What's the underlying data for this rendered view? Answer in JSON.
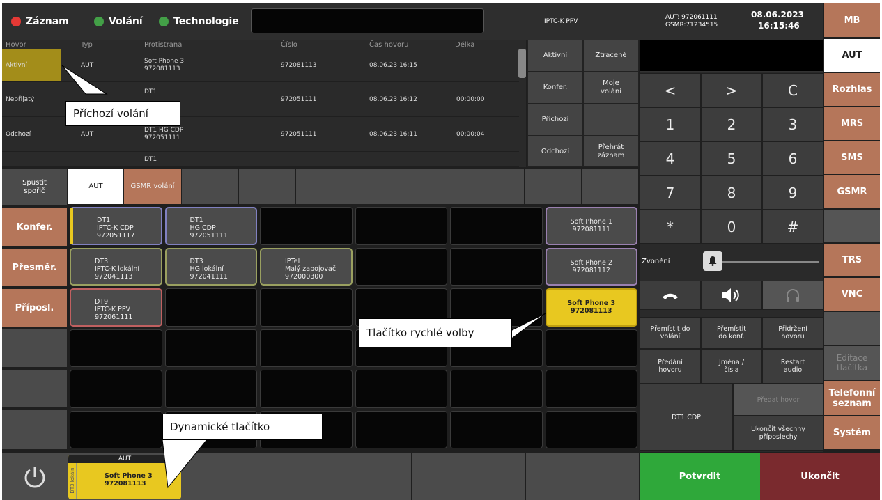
{
  "header": {
    "indicators": [
      {
        "label": "Záznam",
        "color": "#e53935"
      },
      {
        "label": "Volání",
        "color": "#43a047"
      },
      {
        "label": "Technologie",
        "color": "#43a047"
      }
    ],
    "center_label": "IPTC-K PPV",
    "aut_line": "AUT: 972061111",
    "gsmr_line": "GSMR:71234515",
    "date": "08.06.2023",
    "time": "16:15:46"
  },
  "history": {
    "columns": [
      "Hovor",
      "Typ",
      "Protistrana",
      "Číslo",
      "Čas hovoru",
      "Délka"
    ],
    "rows": [
      {
        "status": "Aktivní",
        "type": "AUT",
        "party1": "Soft Phone 3",
        "party2": "972081113",
        "number": "972081113",
        "time": "08.06.23 16:15",
        "length": ""
      },
      {
        "status": "Nepřijatý",
        "type": "",
        "party1": "DT1",
        "party2": "",
        "number": "972051111",
        "time": "08.06.23 16:12",
        "length": "00:00:00"
      },
      {
        "status": "Odchozí",
        "type": "AUT",
        "party1": "DT1 HG CDP",
        "party2": "972051111",
        "number": "972051111",
        "time": "08.06.23 16:11",
        "length": "00:00:04"
      },
      {
        "status": "",
        "type": "",
        "party1": "DT1",
        "party2": "",
        "number": "",
        "time": "",
        "length": ""
      }
    ]
  },
  "filters": [
    [
      "Aktivní",
      "Ztracené"
    ],
    [
      "Konfer.",
      "Moje volání"
    ],
    [
      "Příchozí",
      ""
    ],
    [
      "Odchozí",
      "Přehrát záznam"
    ]
  ],
  "keypad": [
    "<",
    ">",
    "C",
    "1",
    "2",
    "3",
    "4",
    "5",
    "6",
    "7",
    "8",
    "9",
    "*",
    "0",
    "#"
  ],
  "ringing_label": "Zvonění",
  "function_buttons": [
    "Přemístit do volání",
    "Přemístit do konf.",
    "Přidržení hovoru",
    "Předání hovoru",
    "Jména / čísla",
    "Restart audio"
  ],
  "dt1_cdp_label": "DT1 CDP",
  "transfer_call_label": "Předat hovor",
  "end_all_label": "Ukončit všechny příposlechy",
  "confirm_label": "Potvrdit",
  "end_label": "Ukončit",
  "right_menu": [
    "MB",
    "AUT",
    "Rozhlas",
    "MRS",
    "SMS",
    "GSMR",
    "",
    "TRS",
    "VNC",
    "",
    "Editace tlačítka",
    "Telefonní seznam",
    "Systém"
  ],
  "left_menu": [
    "Konfer.",
    "Přesměr.",
    "Příposl."
  ],
  "screensaver_label": "Spustit spořič",
  "tabs": [
    "AUT",
    "GSMR volání"
  ],
  "speed_dial": [
    {
      "l1": "DT1",
      "l2": "IPTC-K CDP",
      "l3": "972051117",
      "border": "#8080c0"
    },
    {
      "l1": "DT1",
      "l2": "HG CDP",
      "l3": "972051111",
      "border": "#8080c0"
    },
    {
      "l1": "DT3",
      "l2": "IPTC-K lokální",
      "l3": "972041113",
      "border": "#9aa060"
    },
    {
      "l1": "DT3",
      "l2": "HG lokální",
      "l3": "972041111",
      "border": "#9aa060"
    },
    {
      "l1": "IPTel",
      "l2": "Malý zapojovač",
      "l3": "972000300",
      "border": "#9aa060"
    },
    {
      "l1": "DT9",
      "l2": "IPTC-K PPV",
      "l3": "972061111",
      "border": "#c06060"
    }
  ],
  "soft_phones": [
    {
      "l1": "Soft Phone 1",
      "l2": "972081111"
    },
    {
      "l1": "Soft Phone 2",
      "l2": "972081112"
    },
    {
      "l1": "Soft Phone 3",
      "l2": "972081113"
    }
  ],
  "dynamic_button": {
    "header": "AUT",
    "side": "DT3 lokální",
    "l1": "Soft Phone 3",
    "l2": "972081113"
  },
  "callouts": {
    "incoming": "Příchozí volání",
    "speed_dial": "Tlačítko rychlé volby",
    "dynamic": "Dynamické tlačítko"
  }
}
